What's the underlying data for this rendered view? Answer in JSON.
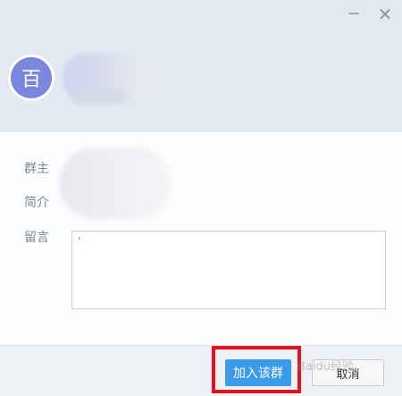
{
  "window": {
    "minimize_glyph": "−",
    "close_glyph": "✕"
  },
  "header": {
    "avatar_char": "百"
  },
  "form": {
    "owner_label": "群主",
    "intro_label": "简介",
    "message_label": "留言",
    "message_value": "'"
  },
  "footer": {
    "join_label": "加入该群",
    "cancel_label": "取消"
  },
  "watermark": {
    "text": "Baidu经验"
  },
  "colors": {
    "accent": "#3c9be8",
    "highlight": "#e2131e",
    "avatar": "#7b86dd"
  },
  "icons": [
    "minimize-icon",
    "close-icon"
  ]
}
